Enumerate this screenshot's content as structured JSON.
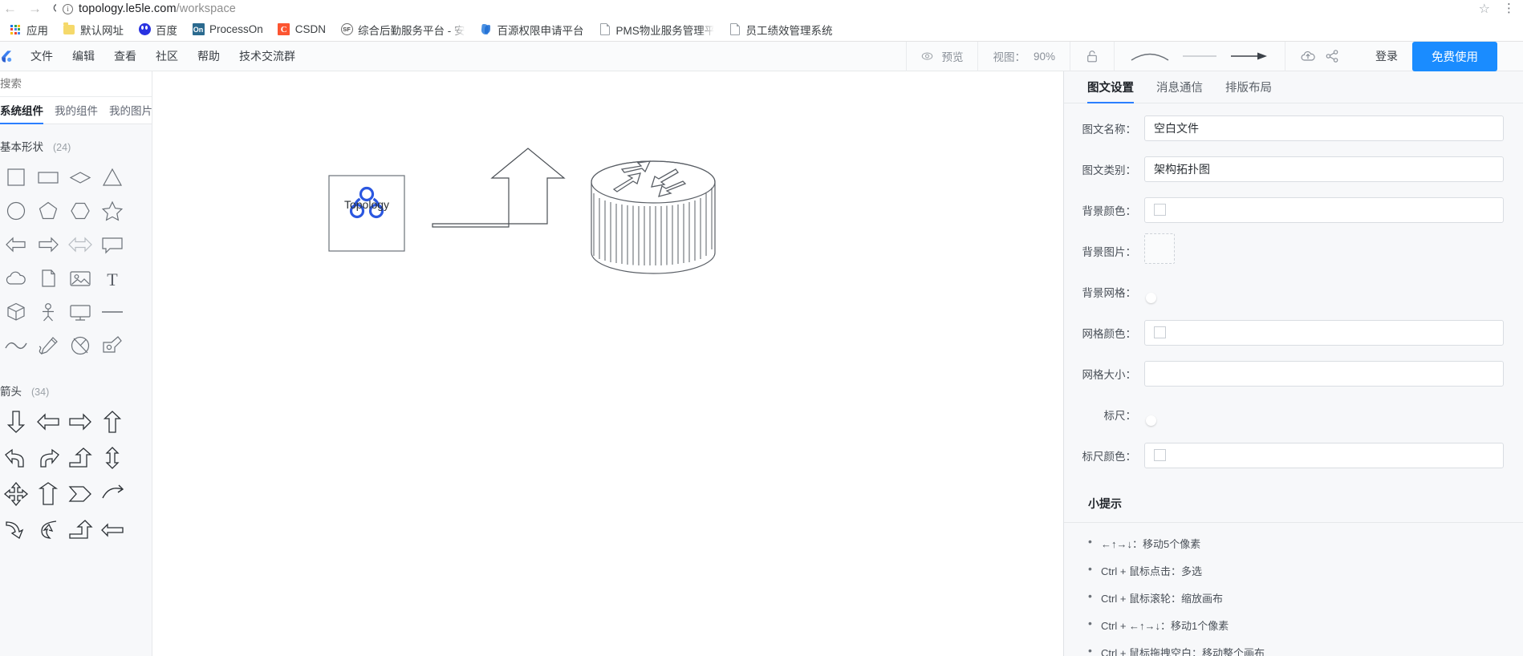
{
  "browser": {
    "url_main": "topology.le5le.com",
    "url_path": "/workspace",
    "back_icon": "back-arrow-icon",
    "forward_icon": "forward-arrow-icon",
    "reload_icon": "reload-icon",
    "info_icon": "info-circle-icon",
    "star_icon": "star-icon",
    "menu_icon": "kebab-menu-icon",
    "bookmarks": [
      {
        "label": "应用",
        "icon": "apps-grid-icon"
      },
      {
        "label": "默认网址",
        "icon": "folder-icon"
      },
      {
        "label": "百度",
        "icon": "baidu-icon"
      },
      {
        "label": "ProcessOn",
        "icon": "processon-icon"
      },
      {
        "label": "CSDN",
        "icon": "csdn-icon"
      },
      {
        "label": "综合后勤服务平台 - 安",
        "icon": "sf-icon"
      },
      {
        "label": "百源权限申请平台",
        "icon": "baiyuan-icon"
      },
      {
        "label": "PMS物业服务管理平台",
        "icon": "document-icon"
      },
      {
        "label": "员工绩效管理系统",
        "icon": "document-icon"
      }
    ]
  },
  "toolbar": {
    "logo": "le5le-logo-icon",
    "menus": [
      "文件",
      "编辑",
      "查看",
      "社区",
      "帮助",
      "技术交流群"
    ],
    "preview_label": "预览",
    "preview_icon": "eye-icon",
    "view_label": "视图：",
    "view_value": "90%",
    "lock_icon": "unlock-icon",
    "curve_icon": "curve-line-icon",
    "straight_icon": "straight-line-icon",
    "arrow_icon": "arrow-line-icon",
    "upload_icon": "cloud-upload-icon",
    "share_icon": "share-icon",
    "login_label": "登录",
    "free_label": "免费使用",
    "accent_color": "#1a8cff"
  },
  "sidebar": {
    "search_placeholder": "搜索",
    "search_value": "",
    "tabs": [
      {
        "label": "系统组件",
        "active": true
      },
      {
        "label": "我的组件",
        "active": false
      },
      {
        "label": "我的图片",
        "active": false
      }
    ],
    "groups": [
      {
        "title": "基本形状",
        "count": "(24)",
        "shapes": [
          "square-shape",
          "rectangle-shape",
          "diamond-shape",
          "triangle-shape",
          "circle-shape",
          "pentagon-shape",
          "hexagon-shape",
          "star-shape",
          "arrow-left-shape",
          "arrow-right-shape",
          "arrow-double-shape",
          "speech-bubble-shape",
          "cloud-shape",
          "file-shape",
          "image-shape",
          "text-shape",
          "cube-shape",
          "person-shape",
          "monitor-shape",
          "line-shape",
          "wave-shape",
          "pencil-shape",
          "clock-shape",
          "pen-nib-shape"
        ]
      },
      {
        "title": "箭头",
        "count": "(34)",
        "shapes": [
          "arrow-down-thick",
          "arrow-left-thick",
          "arrow-right-thick",
          "arrow-up-thick",
          "arrow-curve-left",
          "arrow-curve-right",
          "arrow-bend-up",
          "arrow-up-down",
          "arrow-four-way",
          "arrow-up-block",
          "arrow-pentagon",
          "arrow-arc",
          "arrow-curve-down",
          "arrow-swirl",
          "arrow-bend-left",
          "arrow-long-left"
        ]
      }
    ]
  },
  "canvas": {
    "nodes": [
      {
        "name": "topology-node",
        "label": "Topology",
        "icon": "topology-icon",
        "icon_color": "#2b57e0"
      },
      {
        "name": "up-arrow-node",
        "label": "",
        "icon": "bent-up-arrow-shape"
      },
      {
        "name": "database-node",
        "label": "",
        "icon": "database-cylinder-shape"
      }
    ]
  },
  "rightpanel": {
    "tabs": [
      {
        "label": "图文设置",
        "active": true
      },
      {
        "label": "消息通信",
        "active": false
      },
      {
        "label": "排版布局",
        "active": false
      }
    ],
    "fields": [
      {
        "label": "图文名称：",
        "type": "text",
        "value": "空白文件",
        "name": "graph-name-field"
      },
      {
        "label": "图文类别：",
        "type": "text",
        "value": "架构拓扑图",
        "name": "graph-category-field"
      },
      {
        "label": "背景颜色：",
        "type": "color",
        "value": "",
        "name": "background-color-field"
      },
      {
        "label": "背景图片：",
        "type": "image",
        "value": "",
        "name": "background-image-field"
      },
      {
        "label": "背景网格：",
        "type": "toggle",
        "value": "off",
        "name": "background-grid-toggle"
      },
      {
        "label": "网格颜色：",
        "type": "color",
        "value": "",
        "name": "grid-color-field"
      },
      {
        "label": "网格大小：",
        "type": "text",
        "value": "",
        "name": "grid-size-field"
      },
      {
        "label": "标尺：",
        "type": "toggle",
        "value": "off",
        "name": "ruler-toggle"
      },
      {
        "label": "标尺颜色：",
        "type": "color",
        "value": "",
        "name": "ruler-color-field"
      }
    ],
    "tips_title": "小提示",
    "tips": [
      "←↑→↓：移动5个像素",
      "Ctrl + 鼠标点击：多选",
      "Ctrl + 鼠标滚轮：缩放画布",
      "Ctrl + ←↑→↓：移动1个像素",
      "Ctrl + 鼠标拖拽空白：移动整个画布"
    ]
  }
}
